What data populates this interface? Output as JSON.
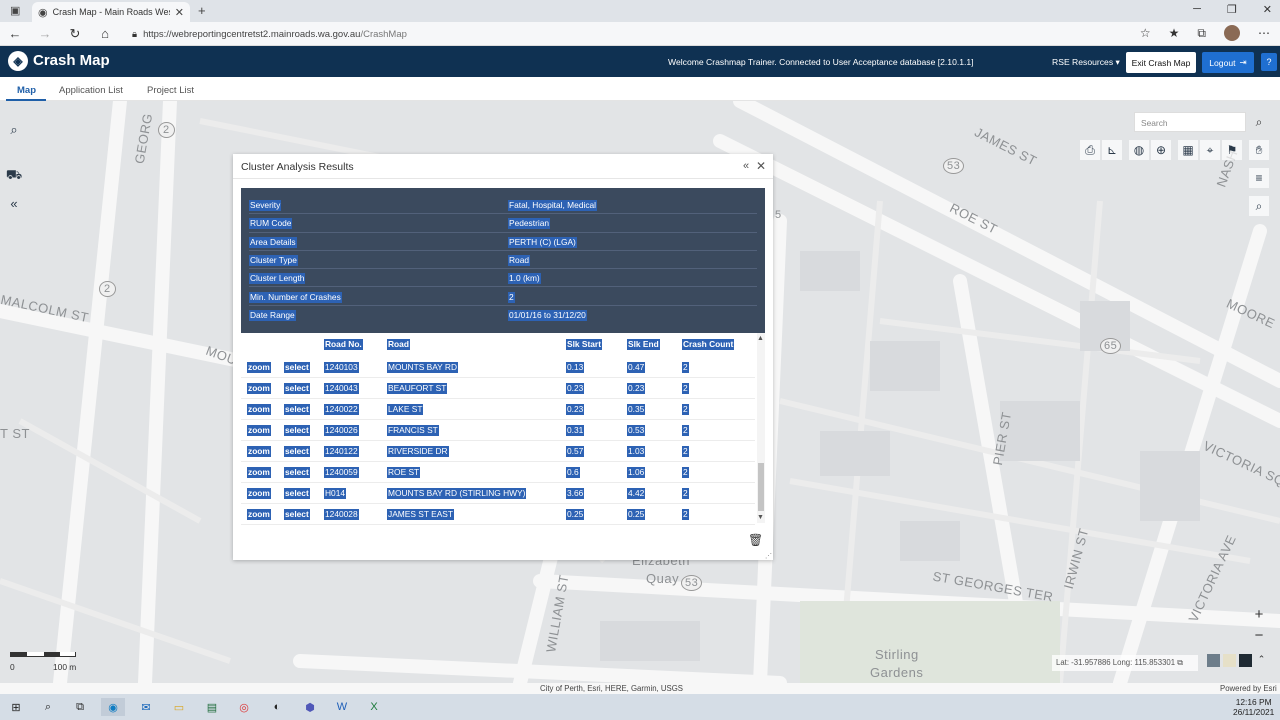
{
  "browser": {
    "tab_title": "Crash Map - Main Roads Wester",
    "url_host": "https://webreportingcentretst2.mainroads.wa.gov.au",
    "url_path": "/CrashMap"
  },
  "app": {
    "title": "Crash Map",
    "welcome": "Welcome Crashmap Trainer. Connected to User Acceptance database [2.10.1.1]",
    "rse_resources": "RSE Resources",
    "exit_button": "Exit Crash Map",
    "logout_button": "Logout",
    "help_button": "?",
    "tabs": [
      {
        "label": "Map"
      },
      {
        "label": "Application List"
      },
      {
        "label": "Project List"
      }
    ]
  },
  "map": {
    "search_placeholder": "Search",
    "labels": [
      "GEORG",
      "MOUNT",
      "MALCOLM ST",
      "T ST",
      "JAMES ST",
      "ROE ST",
      "NASH",
      "MOORE",
      "PIER ST",
      "VICTORIA SQ",
      "ST GEORGES TER",
      "IRWIN ST",
      "VICTORIA AVE",
      "WILLIAM ST",
      "Elizabeth",
      "Quay",
      "Stirling",
      "Gardens",
      "2",
      "2",
      "53",
      "65",
      "53",
      "5"
    ],
    "scale_zero": "0",
    "scale_label": "100 m",
    "latlong": "Lat: -31.957886 Long: 115.853301",
    "attribution": "City of Perth, Esri, HERE, Garmin, USGS",
    "powered_by": "Powered by Esri"
  },
  "dialog": {
    "title": "Cluster Analysis Results",
    "summary": [
      {
        "key": "Severity",
        "value": "Fatal, Hospital, Medical"
      },
      {
        "key": "RUM Code",
        "value": "Pedestrian"
      },
      {
        "key": "Area Details",
        "value": "PERTH (C) (LGA)"
      },
      {
        "key": "Cluster Type",
        "value": "Road"
      },
      {
        "key": "Cluster Length",
        "value": "1.0 (km)"
      },
      {
        "key": "Min. Number of Crashes",
        "value": "2"
      },
      {
        "key": "Date Range",
        "value": "01/01/16 to 31/12/20"
      }
    ],
    "columns": {
      "road_no": "Road No.",
      "road": "Road",
      "slk_start": "Slk Start",
      "slk_end": "Slk End",
      "crash_count": "Crash Count"
    },
    "zoom_label": "zoom",
    "select_label": "select",
    "rows": [
      {
        "road_no": "1240103",
        "road": "MOUNTS BAY RD",
        "slk_start": "0.13",
        "slk_end": "0.47",
        "crash_count": "2"
      },
      {
        "road_no": "1240043",
        "road": "BEAUFORT ST",
        "slk_start": "0.23",
        "slk_end": "0.23",
        "crash_count": "2"
      },
      {
        "road_no": "1240022",
        "road": "LAKE ST",
        "slk_start": "0.23",
        "slk_end": "0.35",
        "crash_count": "2"
      },
      {
        "road_no": "1240026",
        "road": "FRANCIS ST",
        "slk_start": "0.31",
        "slk_end": "0.53",
        "crash_count": "2"
      },
      {
        "road_no": "1240122",
        "road": "RIVERSIDE DR",
        "slk_start": "0.57",
        "slk_end": "1.03",
        "crash_count": "2"
      },
      {
        "road_no": "1240059",
        "road": "ROE ST",
        "slk_start": "0.6",
        "slk_end": "1.06",
        "crash_count": "2"
      },
      {
        "road_no": "H014",
        "road": "MOUNTS BAY RD (STIRLING HWY)",
        "slk_start": "3.66",
        "slk_end": "4.42",
        "crash_count": "2"
      },
      {
        "road_no": "1240028",
        "road": "JAMES ST EAST",
        "slk_start": "0.25",
        "slk_end": "0.25",
        "crash_count": "2"
      }
    ]
  },
  "taskbar": {
    "time": "12:16 PM",
    "date": "26/11/2021"
  },
  "colors": {
    "header_bg": "#0f3152",
    "summary_bg": "#3b4a5e",
    "selection": "#2d62b4",
    "logout_bg": "#1f6fd1",
    "map_bg": "#e2e4e6"
  }
}
